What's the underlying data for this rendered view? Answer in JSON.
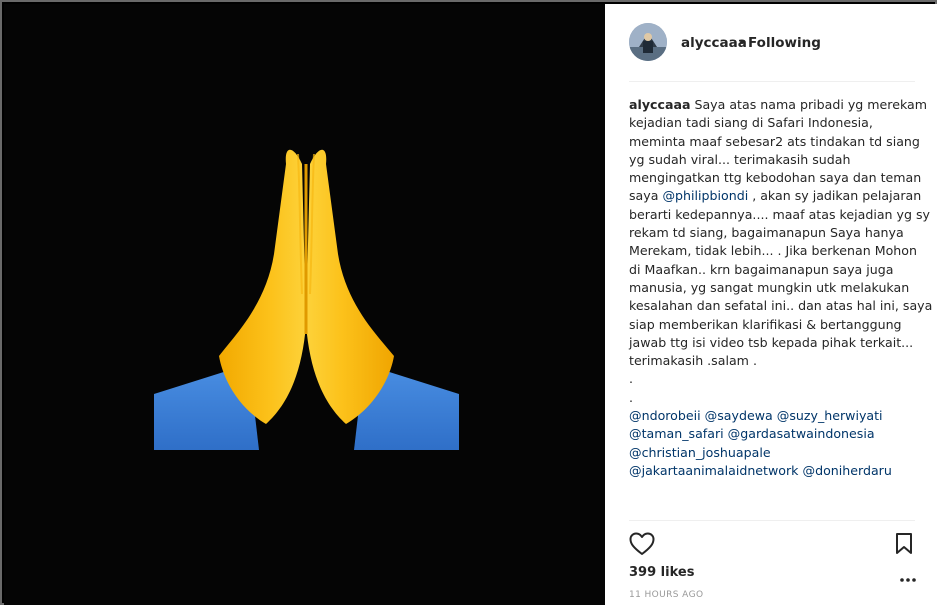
{
  "post": {
    "username": "alyccaaa",
    "separator": "•",
    "follow_status": "Following",
    "likes": "399 likes",
    "timestamp": "11 HOURS AGO"
  },
  "caption": {
    "lines": [
      [
        {
          "t": "alyccaaa",
          "k": "user"
        },
        {
          "t": " Saya atas nama pribadi yg merekam",
          "k": "text"
        }
      ],
      [
        {
          "t": "kejadian tadi siang di Safari Indonesia,",
          "k": "text"
        }
      ],
      [
        {
          "t": "meminta maaf sebesar2 ats tindakan td siang",
          "k": "text"
        }
      ],
      [
        {
          "t": "yg sudah viral... terimakasih sudah",
          "k": "text"
        }
      ],
      [
        {
          "t": "mengingatkan ttg kebodohan saya dan teman",
          "k": "text"
        }
      ],
      [
        {
          "t": "saya ",
          "k": "text"
        },
        {
          "t": "@philipbiondi",
          "k": "mention"
        },
        {
          "t": " , akan sy jadikan pelajaran",
          "k": "text"
        }
      ],
      [
        {
          "t": "berarti kedepannya.... maaf atas kejadian yg sy",
          "k": "text"
        }
      ],
      [
        {
          "t": "rekam td siang, bagaimanapun Saya hanya",
          "k": "text"
        }
      ],
      [
        {
          "t": "Merekam, tidak lebih... . Jika berkenan Mohon",
          "k": "text"
        }
      ],
      [
        {
          "t": "di Maafkan.. krn bagaimanapun saya juga",
          "k": "text"
        }
      ],
      [
        {
          "t": "manusia, yg sangat mungkin utk melakukan",
          "k": "text"
        }
      ],
      [
        {
          "t": "kesalahan dan sefatal ini.. dan atas hal ini, saya",
          "k": "text"
        }
      ],
      [
        {
          "t": "siap memberikan klarifikasi & bertanggung",
          "k": "text"
        }
      ],
      [
        {
          "t": "jawab ttg isi video tsb kepada pihak terkait...",
          "k": "text"
        }
      ],
      [
        {
          "t": "terimakasih .salam .",
          "k": "text"
        }
      ],
      [
        {
          "t": ".",
          "k": "text"
        }
      ],
      [
        {
          "t": ".",
          "k": "text"
        }
      ],
      [
        {
          "t": "@ndorobeii",
          "k": "mention"
        },
        {
          "t": " ",
          "k": "text"
        },
        {
          "t": "@saydewa",
          "k": "mention"
        },
        {
          "t": " ",
          "k": "text"
        },
        {
          "t": "@suzy_herwiyati",
          "k": "mention"
        }
      ],
      [
        {
          "t": "@taman_safari",
          "k": "mention"
        },
        {
          "t": " ",
          "k": "text"
        },
        {
          "t": "@gardasatwaindonesia",
          "k": "mention"
        }
      ],
      [
        {
          "t": "@christian_joshuapale",
          "k": "mention"
        }
      ],
      [
        {
          "t": "@jakartaanimalaidnetwork",
          "k": "mention"
        },
        {
          "t": " ",
          "k": "text"
        },
        {
          "t": "@doniherdaru",
          "k": "mention"
        }
      ]
    ]
  },
  "colors": {
    "mention": "#003569",
    "text": "#262626",
    "muted": "#999999",
    "divider": "#efefef",
    "media_bg": "#050505",
    "hand_yellow": "#f4b400",
    "sleeve_blue": "#3b7dd8"
  },
  "icons": {
    "like": "heart-outline-icon",
    "save": "bookmark-outline-icon",
    "more": "more-options-icon",
    "image": "folded-hands-emoji"
  }
}
